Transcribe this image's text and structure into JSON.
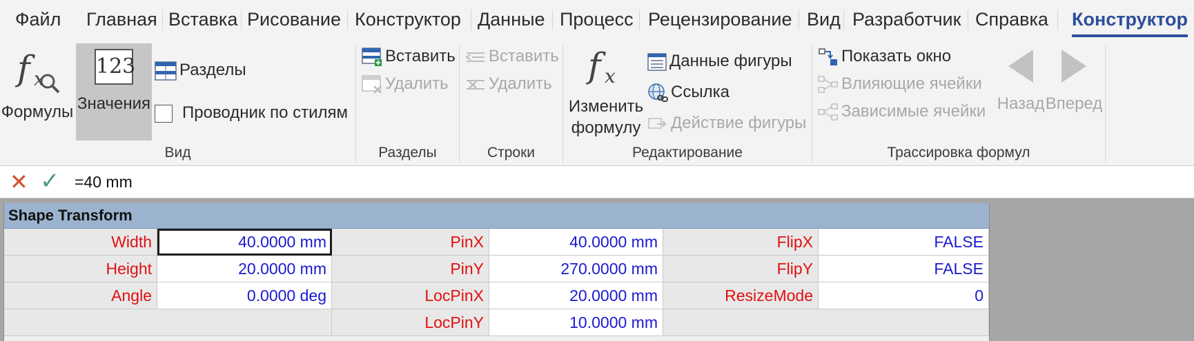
{
  "tabs": [
    "Файл",
    "Главная",
    "Вставка",
    "Рисование",
    "Конструктор",
    "Данные",
    "Процесс",
    "Рецензирование",
    "Вид",
    "Разработчик",
    "Справка",
    "Конструктор"
  ],
  "active_tab": "Конструктор",
  "ribbon": {
    "view": {
      "label": "Вид",
      "formulas": "Формулы",
      "values": "Значения",
      "values_icon_text": "123",
      "sections": "Разделы",
      "style_explorer": "Проводник по стилям"
    },
    "sections": {
      "label": "Разделы",
      "insert": "Вставить",
      "delete": "Удалить"
    },
    "rows": {
      "label": "Строки",
      "insert": "Вставить",
      "delete": "Удалить"
    },
    "editing": {
      "label": "Редактирование",
      "edit_formula_1": "Изменить",
      "edit_formula_2": "формулу",
      "shape_data": "Данные фигуры",
      "link": "Ссылка",
      "shape_action": "Действие фигуры"
    },
    "trace": {
      "label": "Трассировка формул",
      "show_window": "Показать окно",
      "precedents": "Влияющие ячейки",
      "dependents": "Зависимые ячейки",
      "back": "Назад",
      "forward": "Вперед"
    }
  },
  "formula_bar": {
    "value": "=40 mm"
  },
  "sheet": {
    "title": "Shape Transform",
    "rows": [
      {
        "l1": "Width",
        "v1": "40.0000 mm",
        "l2": "PinX",
        "v2": "40.0000 mm",
        "l3": "FlipX",
        "v3": "FALSE"
      },
      {
        "l1": "Height",
        "v1": "20.0000 mm",
        "l2": "PinY",
        "v2": "270.0000 mm",
        "l3": "FlipY",
        "v3": "FALSE"
      },
      {
        "l1": "Angle",
        "v1": "0.0000 deg",
        "l2": "LocPinX",
        "v2": "20.0000 mm",
        "l3": "ResizeMode",
        "v3": "0"
      },
      {
        "l1": "",
        "v1": "",
        "l2": "LocPinY",
        "v2": "10.0000 mm",
        "l3": "",
        "v3": ""
      }
    ]
  },
  "colors": {
    "accent": "#2e4f9e",
    "label_red": "#e01010",
    "value_blue": "#1a1acf",
    "section_header": "#9bb3cf"
  }
}
